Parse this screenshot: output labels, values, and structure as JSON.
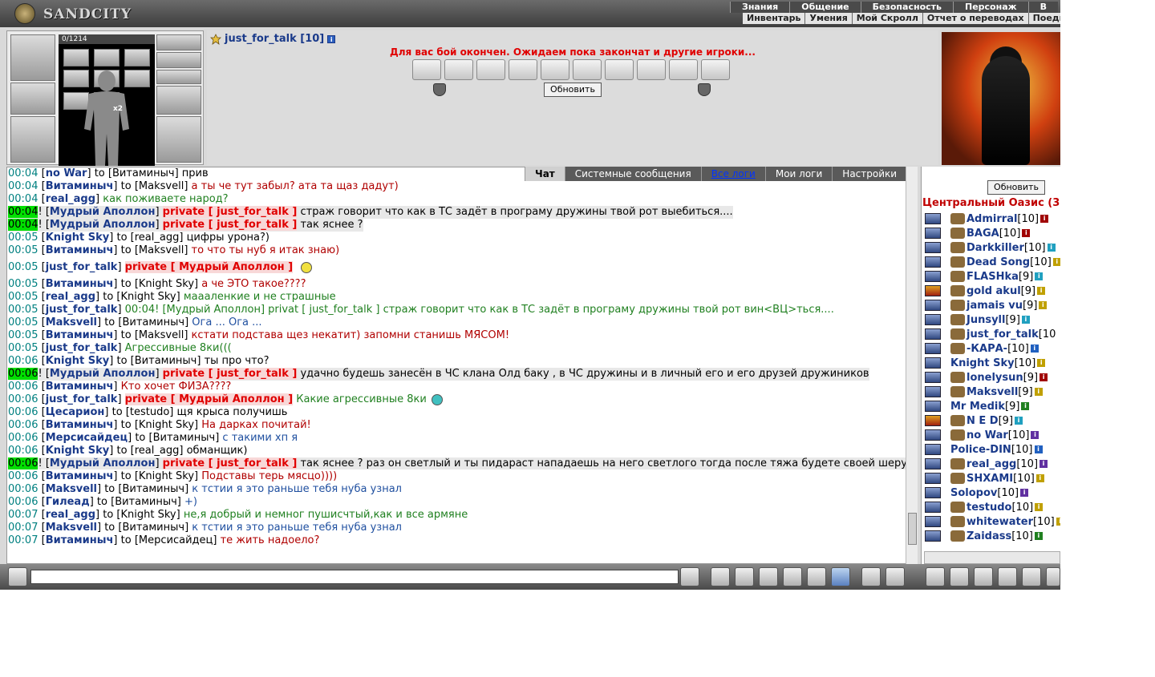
{
  "logo": {
    "text": "SANDCITY"
  },
  "top_menu": [
    "Знания",
    "Общение",
    "Безопасность",
    "Персонаж",
    "В"
  ],
  "sub_menu": [
    "Инвентарь",
    "Умения",
    "Мой Скролл",
    "Отчет о переводах",
    "Поедин"
  ],
  "character": {
    "hp": "0/1214",
    "multiplier": "x2"
  },
  "battle": {
    "player_name": "just_for_talk [10]",
    "message": "Для вас бой окончен. Ожидаем пока закончат и другие игроки...",
    "refresh_label": "Обновить"
  },
  "tabs": [
    {
      "label": "Чат",
      "state": "active"
    },
    {
      "label": "Системные сообщения",
      "state": "normal"
    },
    {
      "label": "Все логи",
      "state": "link"
    },
    {
      "label": "Мои логи",
      "state": "normal"
    },
    {
      "label": "Настройки",
      "state": "normal"
    }
  ],
  "chat": [
    {
      "t": "00:04",
      "n": "no War",
      "to": "Витаминыч",
      "m": "прив",
      "c": "t-dark"
    },
    {
      "t": "00:04",
      "n": "Витаминыч",
      "to": "Maksvell",
      "m": "а ты че тут забыл? ата та щаз дадут)",
      "c": "t-red"
    },
    {
      "t": "00:04",
      "n": "real_agg",
      "m": "как поживаете народ?",
      "c": "t-green"
    },
    {
      "t": "00:04",
      "new": true,
      "n": "Мудрый Аполлон",
      "priv": "private [ just_for_talk ]",
      "m": "страж говорит что как в ТС задёт в програму дружины твой рот выебиться....",
      "c": "t-dark",
      "hl": true
    },
    {
      "t": "00:04",
      "new": true,
      "n": "Мудрый Аполлон",
      "priv": "private [ just_for_talk ]",
      "m": "так яснее ?",
      "c": "t-dark",
      "hl": true
    },
    {
      "t": "00:05",
      "n": "Knight Sky",
      "to": "real_agg",
      "m": "цифры урона?)",
      "c": "t-dark"
    },
    {
      "t": "00:05",
      "n": "Витаминыч",
      "to": "Maksvell",
      "m": "то что ты нуб я итак знаю)",
      "c": "t-red"
    },
    {
      "t": "00:05",
      "n": "just_for_talk",
      "priv": "private [ Мудрый Аполлон ]",
      "m": "",
      "c": "t-dark",
      "smiley": "#f0e040",
      "tall": true
    },
    {
      "t": "00:05",
      "n": "Витаминыч",
      "to": "Knight Sky",
      "m": "а че ЭТО такое????",
      "c": "t-red"
    },
    {
      "t": "00:05",
      "n": "real_agg",
      "to": "Knight Sky",
      "m": "маааленкие и не страшные",
      "c": "t-green"
    },
    {
      "t": "00:05",
      "n": "just_for_talk",
      "m": "00:04! [Мудрый Аполлон] privat [ just_for_talk ] страж говорит что как в ТС задёт в програму дружины твой рот вин<ВЦ>ться....",
      "c": "t-green"
    },
    {
      "t": "00:05",
      "n": "Maksvell",
      "to": "Витаминыч",
      "m": "Ога ... Ога ...",
      "c": "t-blue"
    },
    {
      "t": "00:05",
      "n": "Витаминыч",
      "to": "Maksvell",
      "m": "кстати подстава щез некатит) запомни станишь МЯСОМ!",
      "c": "t-red"
    },
    {
      "t": "00:05",
      "n": "just_for_talk",
      "m": "Агрессивные 8ки(((",
      "c": "t-green"
    },
    {
      "t": "00:06",
      "n": "Knight Sky",
      "to": "Витаминыч",
      "m": "ты про что?",
      "c": "t-dark"
    },
    {
      "t": "00:06",
      "new": true,
      "n": "Мудрый Аполлон",
      "priv": "private [ just_for_talk ]",
      "m": "удачно будешь занесён в ЧС клана Олд баку , в ЧС дружины и в личный его и его друзей дружиников",
      "c": "t-dark",
      "hl": true
    },
    {
      "t": "00:06",
      "n": "Витаминыч",
      "m": "Кто хочет ФИЗА????",
      "c": "t-red"
    },
    {
      "t": "00:06",
      "n": "just_for_talk",
      "priv": "private [ Мудрый Аполлон ]",
      "m": "Какие агрессивные 8ки",
      "c": "t-green",
      "smiley": "#40c0c0"
    },
    {
      "t": "00:06",
      "n": "Цесарион",
      "to": "testudo",
      "m": "щя крыса получишь",
      "c": "t-dark"
    },
    {
      "t": "00:06",
      "n": "Витаминыч",
      "to": "Knight Sky",
      "m": "На дарках почитай!",
      "c": "t-red"
    },
    {
      "t": "00:06",
      "n": "Мерсисайдец",
      "to": "Витаминыч",
      "m": "с такими хп я",
      "c": "t-blue"
    },
    {
      "t": "00:06",
      "n": "Knight Sky",
      "to": "real_agg",
      "m": "обманщик)",
      "c": "t-dark"
    },
    {
      "t": "00:06",
      "new": true,
      "n": "Мудрый Аполлон",
      "priv": "private [ just_for_talk ]",
      "m": "так яснее ? раз он светлый и ты пидараст нападаешь на него светлого тогда после тяжа будете своей шерушой хуй сосать",
      "c": "t-dark",
      "hl": true,
      "wrap": true
    },
    {
      "t": "00:06",
      "n": "Витаминыч",
      "to": "Knight Sky",
      "m": "Подставы терь мясцо))))",
      "c": "t-red"
    },
    {
      "t": "00:06",
      "n": "Maksvell",
      "to": "Витаминыч",
      "m": "к тстии я это раньше тебя нуба узнал",
      "c": "t-blue"
    },
    {
      "t": "00:06",
      "n": "Гилеад",
      "to": "Витаминыч",
      "m": "+)",
      "c": "t-blue"
    },
    {
      "t": "00:07",
      "n": "real_agg",
      "to": "Knight Sky",
      "m": "не,я добрый и немног пушисчтый,как и все армяне",
      "c": "t-green"
    },
    {
      "t": "00:07",
      "n": "Maksvell",
      "to": "Витаминыч",
      "m": "к тстии я это раньше тебя нуба узнал",
      "c": "t-blue"
    },
    {
      "t": "00:07",
      "n": "Витаминыч",
      "to": "Мерсисайдец",
      "m": "те жить надоело?",
      "c": "t-red"
    }
  ],
  "online": {
    "refresh_label": "Обновить",
    "title": "Центральный Оазис (3",
    "players": [
      {
        "name": "Admirral",
        "level": "[10]",
        "info": "#a00000",
        "clan": true
      },
      {
        "name": "BAGA",
        "level": "[10]",
        "info": "#a00000",
        "clan": true
      },
      {
        "name": "Darkkiller",
        "level": "[10]",
        "info": "#20a0c0",
        "clan": true
      },
      {
        "name": "Dead Song",
        "level": "[10]",
        "info": "#c0a000",
        "clan": true
      },
      {
        "name": "FLASHka",
        "level": "[9]",
        "info": "#20a0c0",
        "clan": true
      },
      {
        "name": "gold akul",
        "level": "[9]",
        "info": "#c0a000",
        "clan": true,
        "warn": true
      },
      {
        "name": "jamais vu",
        "level": "[9]",
        "info": "#c0a000",
        "clan": true
      },
      {
        "name": "Junsyll",
        "level": "[9]",
        "info": "#20a0c0",
        "clan": true
      },
      {
        "name": "just_for_talk",
        "level": "[10",
        "info": "",
        "clan": true
      },
      {
        "name": "-КАРА-",
        "level": "[10]",
        "info": "#2060c0",
        "clan": true
      },
      {
        "name": "Knight Sky",
        "level": "[10]",
        "info": "#c0a000",
        "clan": false
      },
      {
        "name": "lonelysun",
        "level": "[9]",
        "info": "#a00000",
        "clan": true
      },
      {
        "name": "Maksvell",
        "level": "[9]",
        "info": "#c0a000",
        "clan": true
      },
      {
        "name": "Mr Medik",
        "level": "[9]",
        "info": "#208020",
        "clan": false
      },
      {
        "name": "N E D",
        "level": "[9]",
        "info": "#20a0c0",
        "clan": true,
        "warn": true
      },
      {
        "name": "no War",
        "level": "[10]",
        "info": "#6030a0",
        "clan": true
      },
      {
        "name": "Police-DIN",
        "level": "[10]",
        "info": "#2060c0",
        "clan": false
      },
      {
        "name": "real_agg",
        "level": "[10]",
        "info": "#6030a0",
        "clan": true
      },
      {
        "name": "SHXAMI",
        "level": "[10]",
        "info": "#c0a000",
        "clan": true
      },
      {
        "name": "Solopov",
        "level": "[10]",
        "info": "#6030a0",
        "clan": false
      },
      {
        "name": "testudo",
        "level": "[10]",
        "info": "#c0a000",
        "clan": true
      },
      {
        "name": "whitewater",
        "level": "[10]",
        "info": "#c0a000",
        "clan": true
      },
      {
        "name": "Zaidass",
        "level": "[10]",
        "info": "#208020",
        "clan": true
      }
    ]
  },
  "input": {
    "value": ""
  },
  "colors": {
    "accent": "#1a3a8a",
    "private": "#e00000",
    "new_marker": "#00e000"
  }
}
